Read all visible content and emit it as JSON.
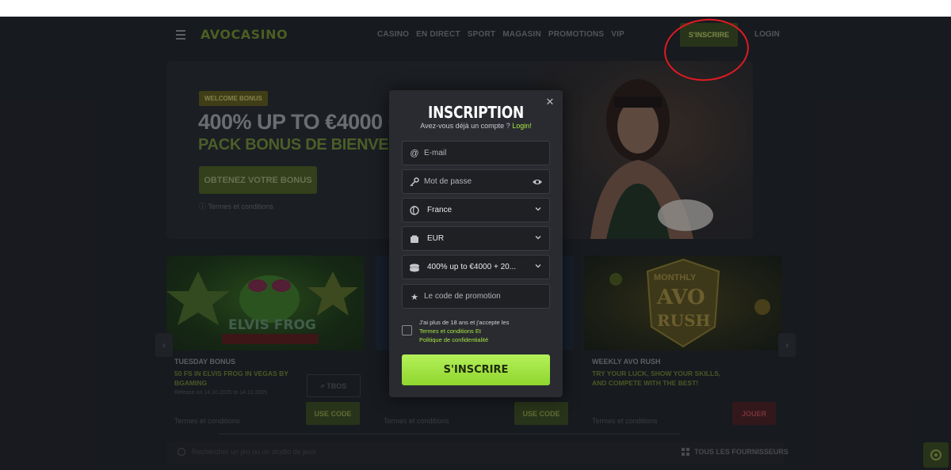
{
  "header": {
    "logo": "AVOCASINO",
    "nav": [
      "CASINO",
      "EN DIRECT",
      "SPORT",
      "MAGASIN",
      "PROMOTIONS",
      "VIP"
    ],
    "signup_label": "S'INSCRIRE",
    "login_label": "LOGIN"
  },
  "hero": {
    "badge": "WELCOME BONUS",
    "title": "400% UP TO €4000 + 20",
    "subtitle": "PACK BONUS DE BIENVENUE",
    "cta": "OBTENEZ VOTRE BONUS",
    "terms": "Termes et conditions"
  },
  "cards": [
    {
      "title": "TUESDAY BONUS",
      "desc": "50 FS IN ELVIS FROG IN VEGAS BY BGAMING",
      "date": "Release on 14.10.2025 to 14.10.2025",
      "terms": "Termes et conditions",
      "btn_label": "USE CODE",
      "secondary_label": "TBOS",
      "art_caption": "ELVIS FROG"
    },
    {
      "title": "",
      "desc": "",
      "terms": "Termes et conditions",
      "btn_label": "USE CODE"
    },
    {
      "title": "WEEKLY AVO RUSH",
      "desc": "TRY YOUR LUCK, SHOW YOUR SKILLS, AND COMPETE WITH THE BEST!",
      "terms": "Termes et conditions",
      "btn_label": "JOUER",
      "art_caption_top": "MONTHLY",
      "art_caption_mid": "AVO",
      "art_caption_bottom": "RUSH"
    }
  ],
  "footer": {
    "search_placeholder": "Rechercher un jeu ou un studio de jeux",
    "providers_label": "TOUS LES FOURNISSEURS"
  },
  "modal": {
    "title": "INSCRIPTION",
    "subtitle": "Avez-vous déjà un compte ?",
    "login_link": "Login!",
    "email_placeholder": "E-mail",
    "password_placeholder": "Mot de passe",
    "country_value": "France",
    "currency_value": "EUR",
    "bonus_value": "400% up to €4000 + 20...",
    "promo_placeholder": "Le code de promotion",
    "consent_text": "J'ai plus de 18 ans et j'accepte les",
    "terms_link": "Termes et conditions Et",
    "privacy_link": "Politique de confidentialité",
    "submit_label": "S'INSCRIRE"
  },
  "colors": {
    "accent_green": "#a6e244",
    "annotation_red": "#e01a22",
    "modal_bg": "#292b30"
  },
  "icons": [
    "menu-icon",
    "at-icon",
    "key-icon",
    "eye-icon",
    "globe-icon",
    "wallet-icon",
    "coins-icon",
    "star-icon",
    "chevron-down-icon",
    "close-icon",
    "search-icon",
    "grid-icon",
    "chat-icon"
  ]
}
